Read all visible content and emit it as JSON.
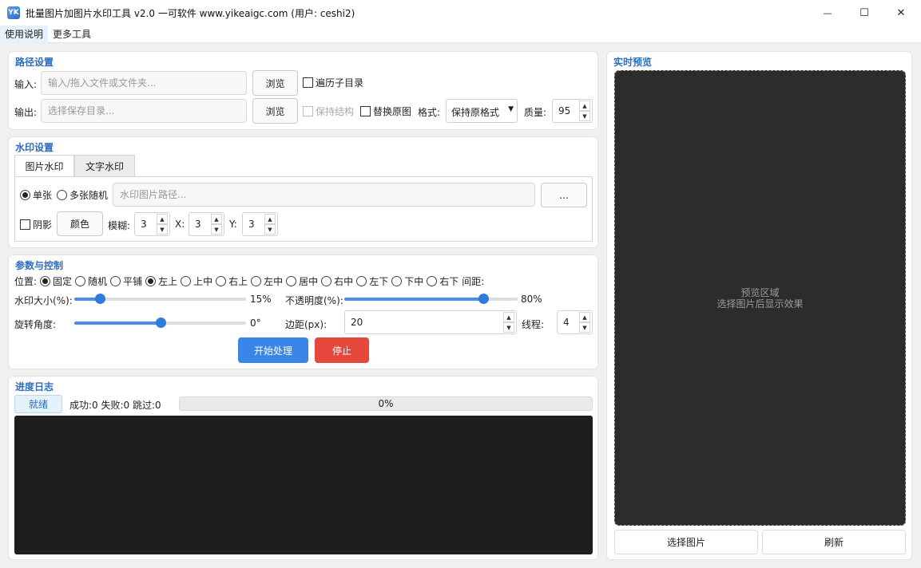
{
  "window": {
    "title": "批量图片加图片水印工具 v2.0 一可软件 www.yikeaigc.com (用户: ceshi2)",
    "app_icon": "YK",
    "minimize_glyph": "—",
    "maximize_glyph": "☐",
    "close_glyph": "✕"
  },
  "menu": [
    "使用说明",
    "更多工具"
  ],
  "path": {
    "title": "路径设置",
    "input_label": "输入:",
    "input_placeholder": "输入/拖入文件或文件夹...",
    "browse_label": "浏览",
    "recurse_label": "遍历子目录",
    "output_label": "输出:",
    "output_placeholder": "选择保存目录...",
    "browse2_label": "浏览",
    "keep_structure_label": "保持结构",
    "replace_label": "替换原图",
    "format_label": "格式:",
    "format_value": "保持原格式",
    "quality_label": "质量:",
    "quality_value": "95"
  },
  "watermark": {
    "title": "水印设置",
    "tabs": [
      "图片水印",
      "文字水印"
    ],
    "single_label": "单张",
    "multi_label": "多张随机",
    "path_placeholder": "水印图片路径...",
    "more_label": "...",
    "shadow_label": "阴影",
    "color_label": "颜色",
    "blur_label": "模糊:",
    "blur_value": "3",
    "x_label": "X:",
    "x_value": "3",
    "y_label": "Y:",
    "y_value": "3"
  },
  "params": {
    "title": "参数与控制",
    "position_label": "位置:",
    "positions": [
      "固定",
      "随机",
      "平铺",
      "左上",
      "上中",
      "右上",
      "左中",
      "居中",
      "右中",
      "左下",
      "下中",
      "右下"
    ],
    "spacing_label": "间距:",
    "size_label": "水印大小(%):",
    "size_value": "15%",
    "size_level": 0.15,
    "opacity_label": "不透明度(%):",
    "opacity_value": "80%",
    "opacity_level": 0.8,
    "rotate_label": "旋转角度:",
    "rotate_value": "0°",
    "rotate_level": 0.5,
    "margin_label": "边距(px):",
    "margin_value": "20",
    "threads_label": "线程:",
    "threads_value": "4",
    "start_label": "开始处理",
    "stop_label": "停止"
  },
  "progress": {
    "title": "进度日志",
    "status": "就绪",
    "counts": "成功:0 失败:0 跳过:0",
    "percent": "0%"
  },
  "preview": {
    "title": "实时预览",
    "area_line1": "预览区域",
    "area_line2": "选择图片后显示效果",
    "select_label": "选择图片",
    "refresh_label": "刷新"
  },
  "colors": {
    "accent": "#2b6cc4",
    "start_button": "#3a86e8",
    "stop_button": "#e5473d",
    "log_bg": "#1e1e1e",
    "preview_bg": "#2c2c2c"
  }
}
